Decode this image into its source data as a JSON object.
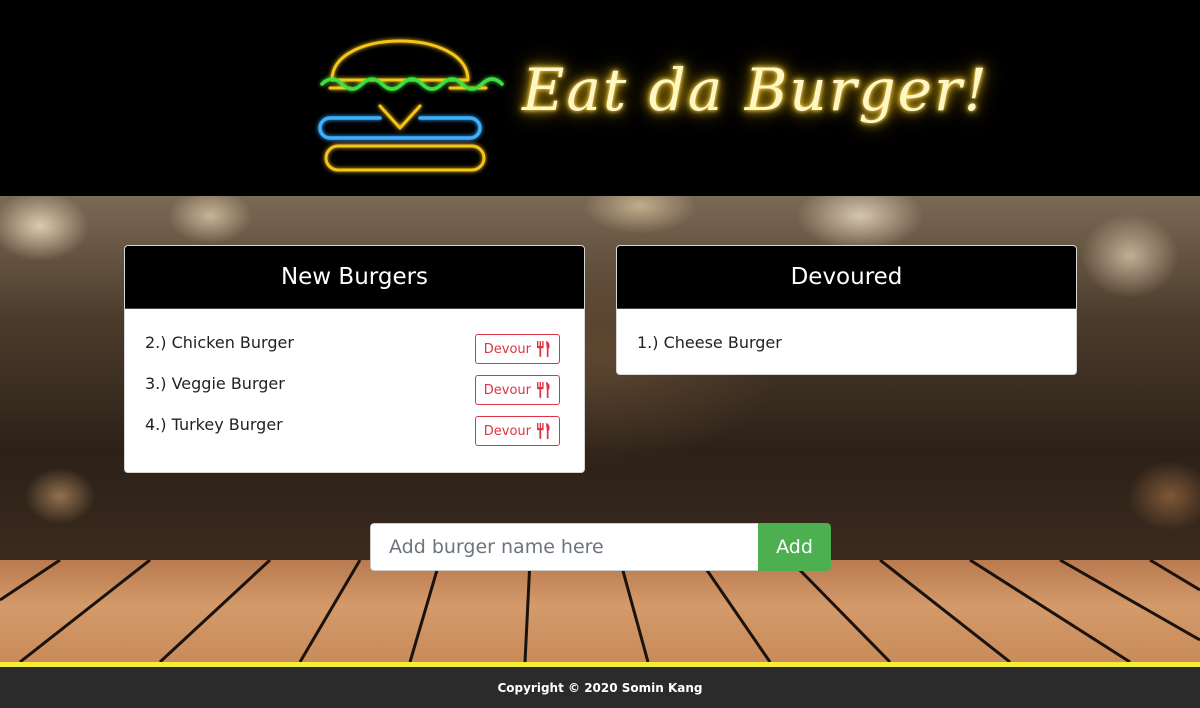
{
  "header": {
    "title": "Eat da Burger!",
    "logo_icon": "neon-burger-icon",
    "colors": {
      "neon_yellow": "#f5c518",
      "neon_green": "#3ee03e",
      "neon_blue": "#3ab0ff"
    }
  },
  "new_burgers": {
    "title": "New Burgers",
    "devour_label": "Devour",
    "devour_icon": "utensils-icon",
    "items": [
      {
        "name": "2.) Chicken Burger"
      },
      {
        "name": "3.) Veggie Burger"
      },
      {
        "name": "4.) Turkey Burger"
      }
    ]
  },
  "devoured": {
    "title": "Devoured",
    "items": [
      {
        "name": "1.) Cheese Burger"
      }
    ]
  },
  "form": {
    "placeholder": "Add burger name here",
    "add_label": "Add",
    "add_color": "#4caf50"
  },
  "footer": {
    "copyright": "Copyright © 2020 Somin Kang"
  }
}
